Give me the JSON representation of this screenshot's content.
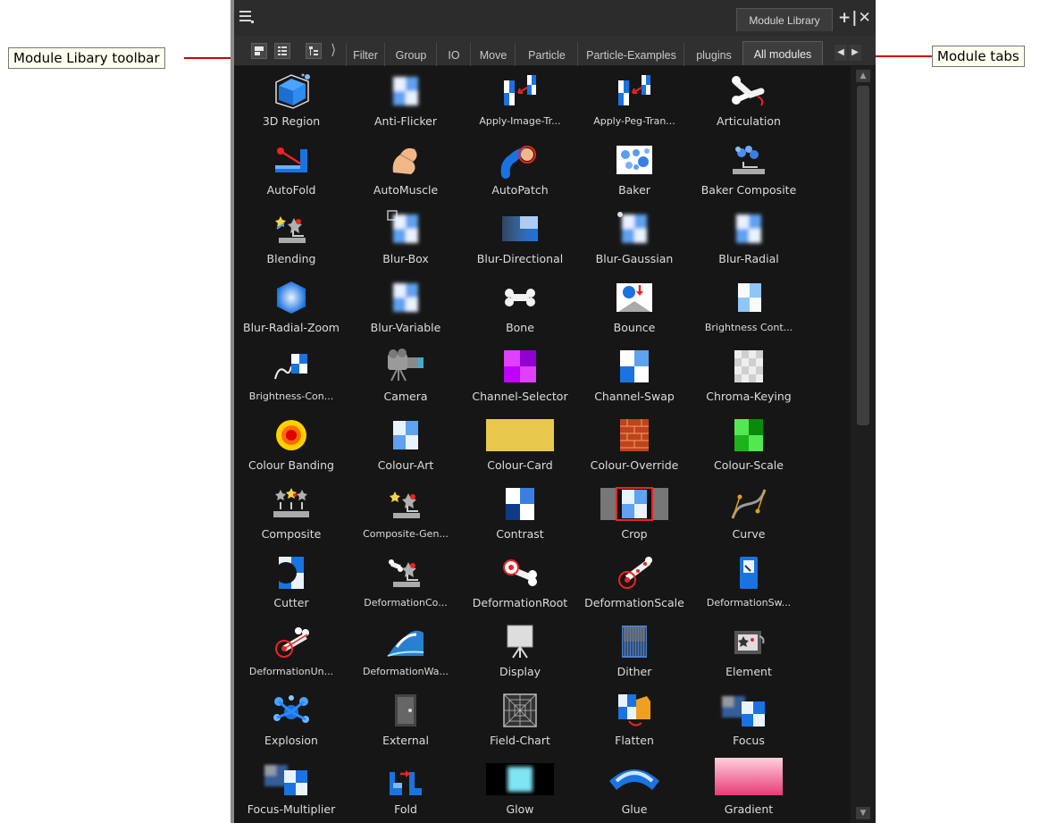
{
  "callouts": {
    "toolbar": "Module Libary toolbar",
    "tabs": "Module tabs"
  },
  "window": {
    "title": "Module Library",
    "controls": "+|✕"
  },
  "toolbar": {
    "separator": "⟩"
  },
  "tabs": [
    {
      "label": "Filter"
    },
    {
      "label": "Group"
    },
    {
      "label": "IO"
    },
    {
      "label": "Move"
    },
    {
      "label": "Particle"
    },
    {
      "label": "Particle-Examples"
    },
    {
      "label": "plugins"
    },
    {
      "label": "All modules",
      "active": true
    }
  ],
  "tab_arrows": {
    "left": "◀",
    "right": "▶"
  },
  "scrollbar": {
    "up": "▲",
    "down": "▼"
  },
  "modules": [
    {
      "label": "3D Region",
      "icon": "3d-region-icon"
    },
    {
      "label": "Anti-Flicker",
      "icon": "anti-flicker-icon"
    },
    {
      "label": "Apply-Image-Tr...",
      "icon": "apply-image-transform-icon",
      "small": true
    },
    {
      "label": "Apply-Peg-Tran...",
      "icon": "apply-peg-transform-icon",
      "small": true
    },
    {
      "label": "Articulation",
      "icon": "articulation-icon"
    },
    {
      "label": "AutoFold",
      "icon": "autofold-icon"
    },
    {
      "label": "AutoMuscle",
      "icon": "automuscle-icon"
    },
    {
      "label": "AutoPatch",
      "icon": "autopatch-icon"
    },
    {
      "label": "Baker",
      "icon": "baker-icon"
    },
    {
      "label": "Baker Composite",
      "icon": "baker-composite-icon"
    },
    {
      "label": "Blending",
      "icon": "blending-icon"
    },
    {
      "label": "Blur-Box",
      "icon": "blur-box-icon"
    },
    {
      "label": "Blur-Directional",
      "icon": "blur-directional-icon"
    },
    {
      "label": "Blur-Gaussian",
      "icon": "blur-gaussian-icon"
    },
    {
      "label": "Blur-Radial",
      "icon": "blur-radial-icon"
    },
    {
      "label": "Blur-Radial-Zoom",
      "icon": "blur-radial-zoom-icon"
    },
    {
      "label": "Blur-Variable",
      "icon": "blur-variable-icon"
    },
    {
      "label": "Bone",
      "icon": "bone-icon"
    },
    {
      "label": "Bounce",
      "icon": "bounce-icon"
    },
    {
      "label": "Brightness Cont...",
      "icon": "brightness-contrast-icon",
      "small": true
    },
    {
      "label": "Brightness-Con...",
      "icon": "brightness-contrast-2-icon",
      "small": true
    },
    {
      "label": "Camera",
      "icon": "camera-icon"
    },
    {
      "label": "Channel-Selector",
      "icon": "channel-selector-icon"
    },
    {
      "label": "Channel-Swap",
      "icon": "channel-swap-icon"
    },
    {
      "label": "Chroma-Keying",
      "icon": "chroma-keying-icon"
    },
    {
      "label": "Colour Banding",
      "icon": "colour-banding-icon"
    },
    {
      "label": "Colour-Art",
      "icon": "colour-art-icon"
    },
    {
      "label": "Colour-Card",
      "icon": "colour-card-icon"
    },
    {
      "label": "Colour-Override",
      "icon": "colour-override-icon"
    },
    {
      "label": "Colour-Scale",
      "icon": "colour-scale-icon"
    },
    {
      "label": "Composite",
      "icon": "composite-icon"
    },
    {
      "label": "Composite-Gen...",
      "icon": "composite-generic-icon",
      "small": true
    },
    {
      "label": "Contrast",
      "icon": "contrast-icon"
    },
    {
      "label": "Crop",
      "icon": "crop-icon"
    },
    {
      "label": "Curve",
      "icon": "curve-icon"
    },
    {
      "label": "Cutter",
      "icon": "cutter-icon"
    },
    {
      "label": "DeformationCo...",
      "icon": "deformation-composite-icon",
      "small": true
    },
    {
      "label": "DeformationRoot",
      "icon": "deformation-root-icon"
    },
    {
      "label": "DeformationScale",
      "icon": "deformation-scale-icon"
    },
    {
      "label": "DeformationSw...",
      "icon": "deformation-switch-icon",
      "small": true
    },
    {
      "label": "DeformationUn...",
      "icon": "deformation-uniform-scale-icon",
      "small": true
    },
    {
      "label": "DeformationWa...",
      "icon": "deformation-wave-icon",
      "small": true
    },
    {
      "label": "Display",
      "icon": "display-icon"
    },
    {
      "label": "Dither",
      "icon": "dither-icon"
    },
    {
      "label": "Element",
      "icon": "element-icon"
    },
    {
      "label": "Explosion",
      "icon": "explosion-icon"
    },
    {
      "label": "External",
      "icon": "external-icon"
    },
    {
      "label": "Field-Chart",
      "icon": "field-chart-icon"
    },
    {
      "label": "Flatten",
      "icon": "flatten-icon"
    },
    {
      "label": "Focus",
      "icon": "focus-icon"
    },
    {
      "label": "Focus-Multiplier",
      "icon": "focus-multiplier-icon"
    },
    {
      "label": "Fold",
      "icon": "fold-icon"
    },
    {
      "label": "Glow",
      "icon": "glow-icon"
    },
    {
      "label": "Glue",
      "icon": "glue-icon"
    },
    {
      "label": "Gradient",
      "icon": "gradient-icon"
    }
  ]
}
